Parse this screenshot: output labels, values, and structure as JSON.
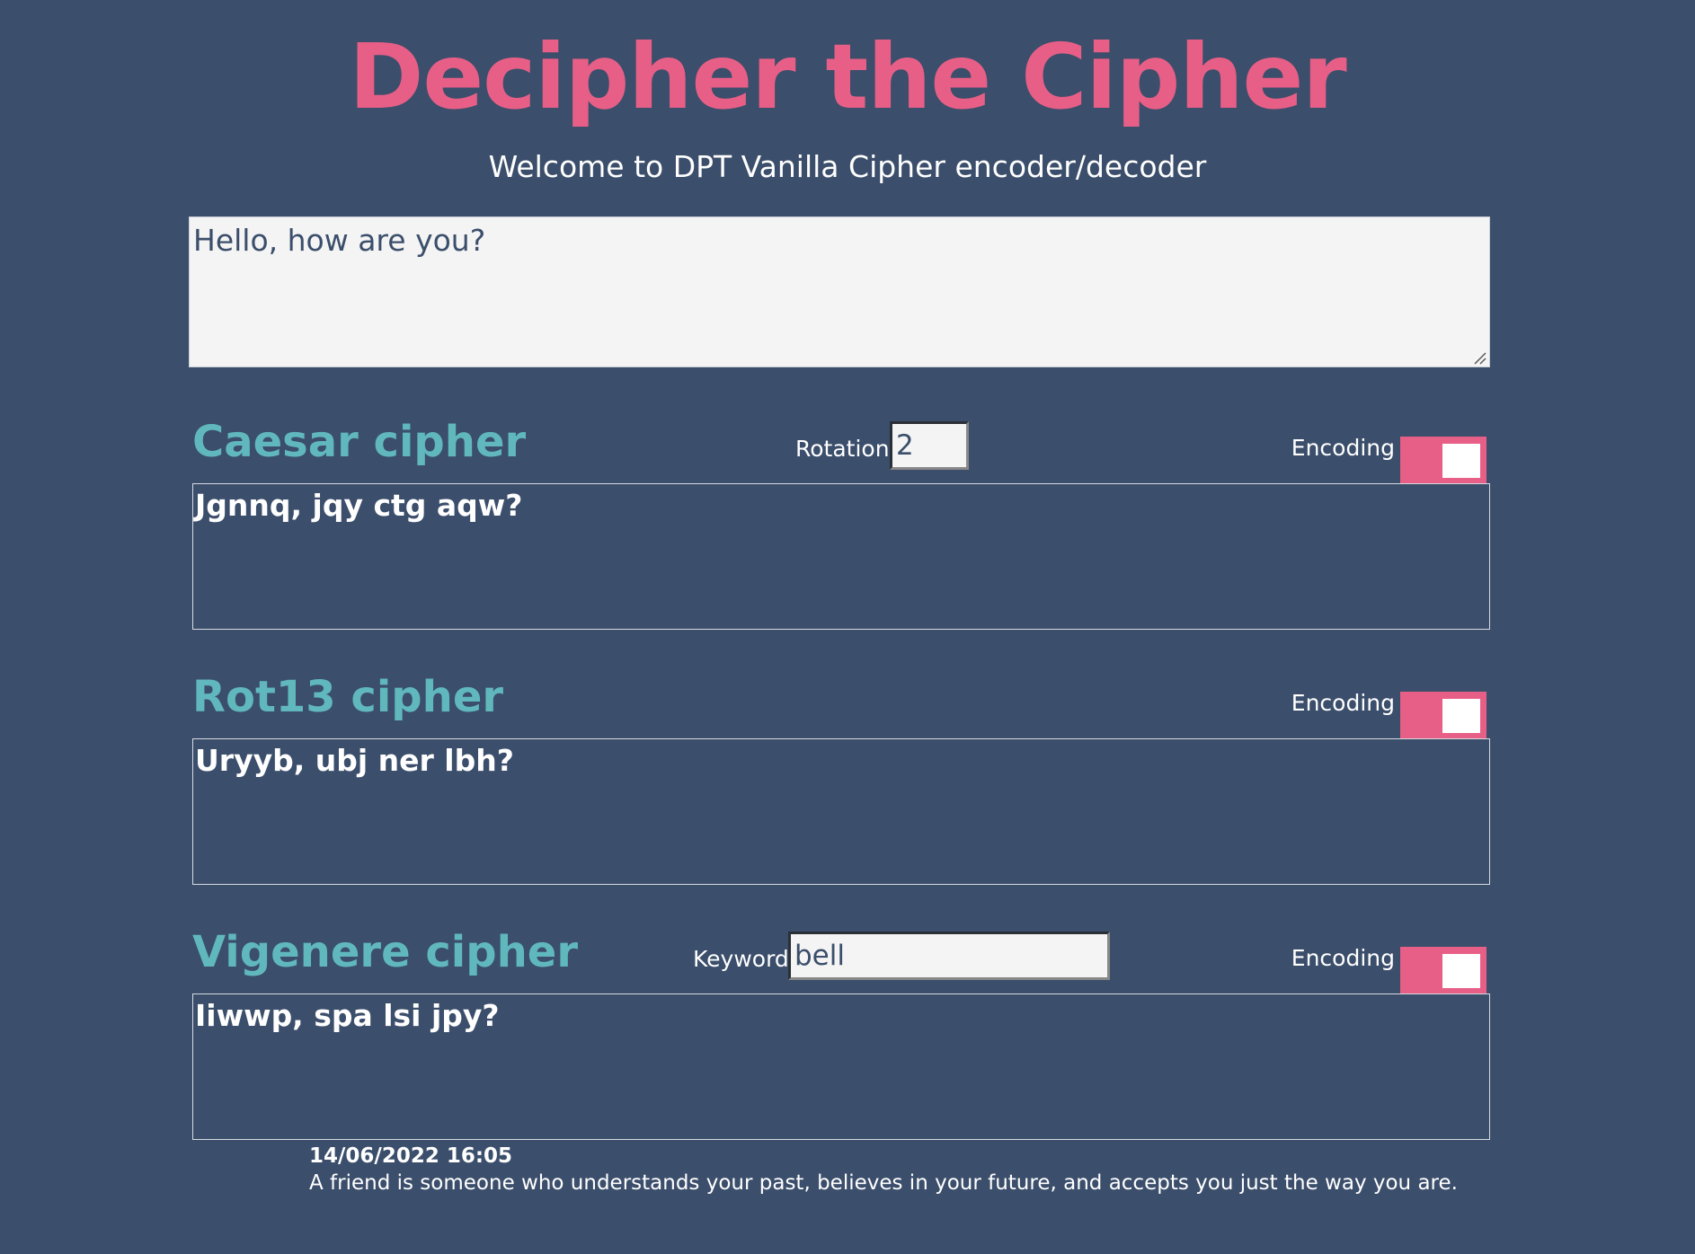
{
  "header": {
    "title": "Decipher the Cipher",
    "subtitle": "Welcome to DPT Vanilla Cipher encoder/decoder"
  },
  "input": {
    "text": "Hello, how are you?"
  },
  "caesar": {
    "title": "Caesar cipher",
    "rotation_label": "Rotation:",
    "rotation_value": "2",
    "encoding_label": "Encoding",
    "encoding_on": true,
    "output": "Jgnnq, jqy ctg aqw?"
  },
  "rot13": {
    "title": "Rot13 cipher",
    "encoding_label": "Encoding",
    "encoding_on": true,
    "output": "Uryyb, ubj ner lbh?"
  },
  "vigenere": {
    "title": "Vigenere cipher",
    "keyword_label": "Keyword:",
    "keyword_value": "bell",
    "encoding_label": "Encoding",
    "encoding_on": true,
    "output": "Iiwwp, spa lsi jpy?"
  },
  "footer": {
    "date": "14/06/2022 16:05",
    "quote": "A friend is someone who understands your past, believes in your future, and accepts you just the way you are."
  },
  "colors": {
    "background": "#3b4e6b",
    "accent_pink": "#e75f86",
    "section_teal": "#60b8bd",
    "input_bg": "#f4f4f4"
  }
}
